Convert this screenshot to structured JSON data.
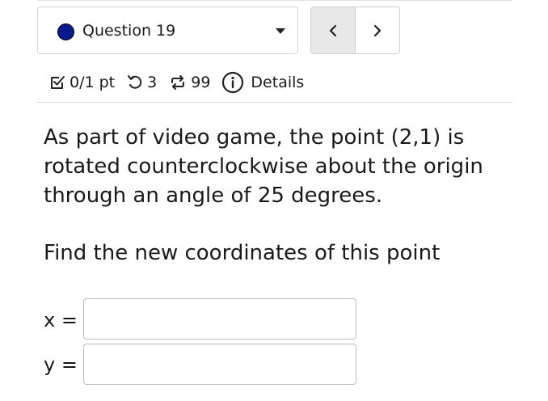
{
  "question_nav": {
    "selected_question": "Question 19",
    "status_color": "#0a1a8c",
    "prev_icon": "chevron-left-icon",
    "next_icon": "chevron-right-icon"
  },
  "meta": {
    "score": "0/1 pt",
    "attempts_remaining": "3",
    "retries": "99",
    "details_label": "Details",
    "score_icon": "checkbox-icon",
    "attempts_icon": "undo-icon",
    "retries_icon": "repeat-icon",
    "details_icon": "info-icon"
  },
  "question": {
    "text": "As part of video game, the point (2,1) is rotated counterclockwise about the origin through an angle of 25 degrees.",
    "prompt": "Find the new coordinates of this point"
  },
  "answers": {
    "x_label": "x =",
    "y_label": "y =",
    "x_value": "",
    "y_value": ""
  }
}
